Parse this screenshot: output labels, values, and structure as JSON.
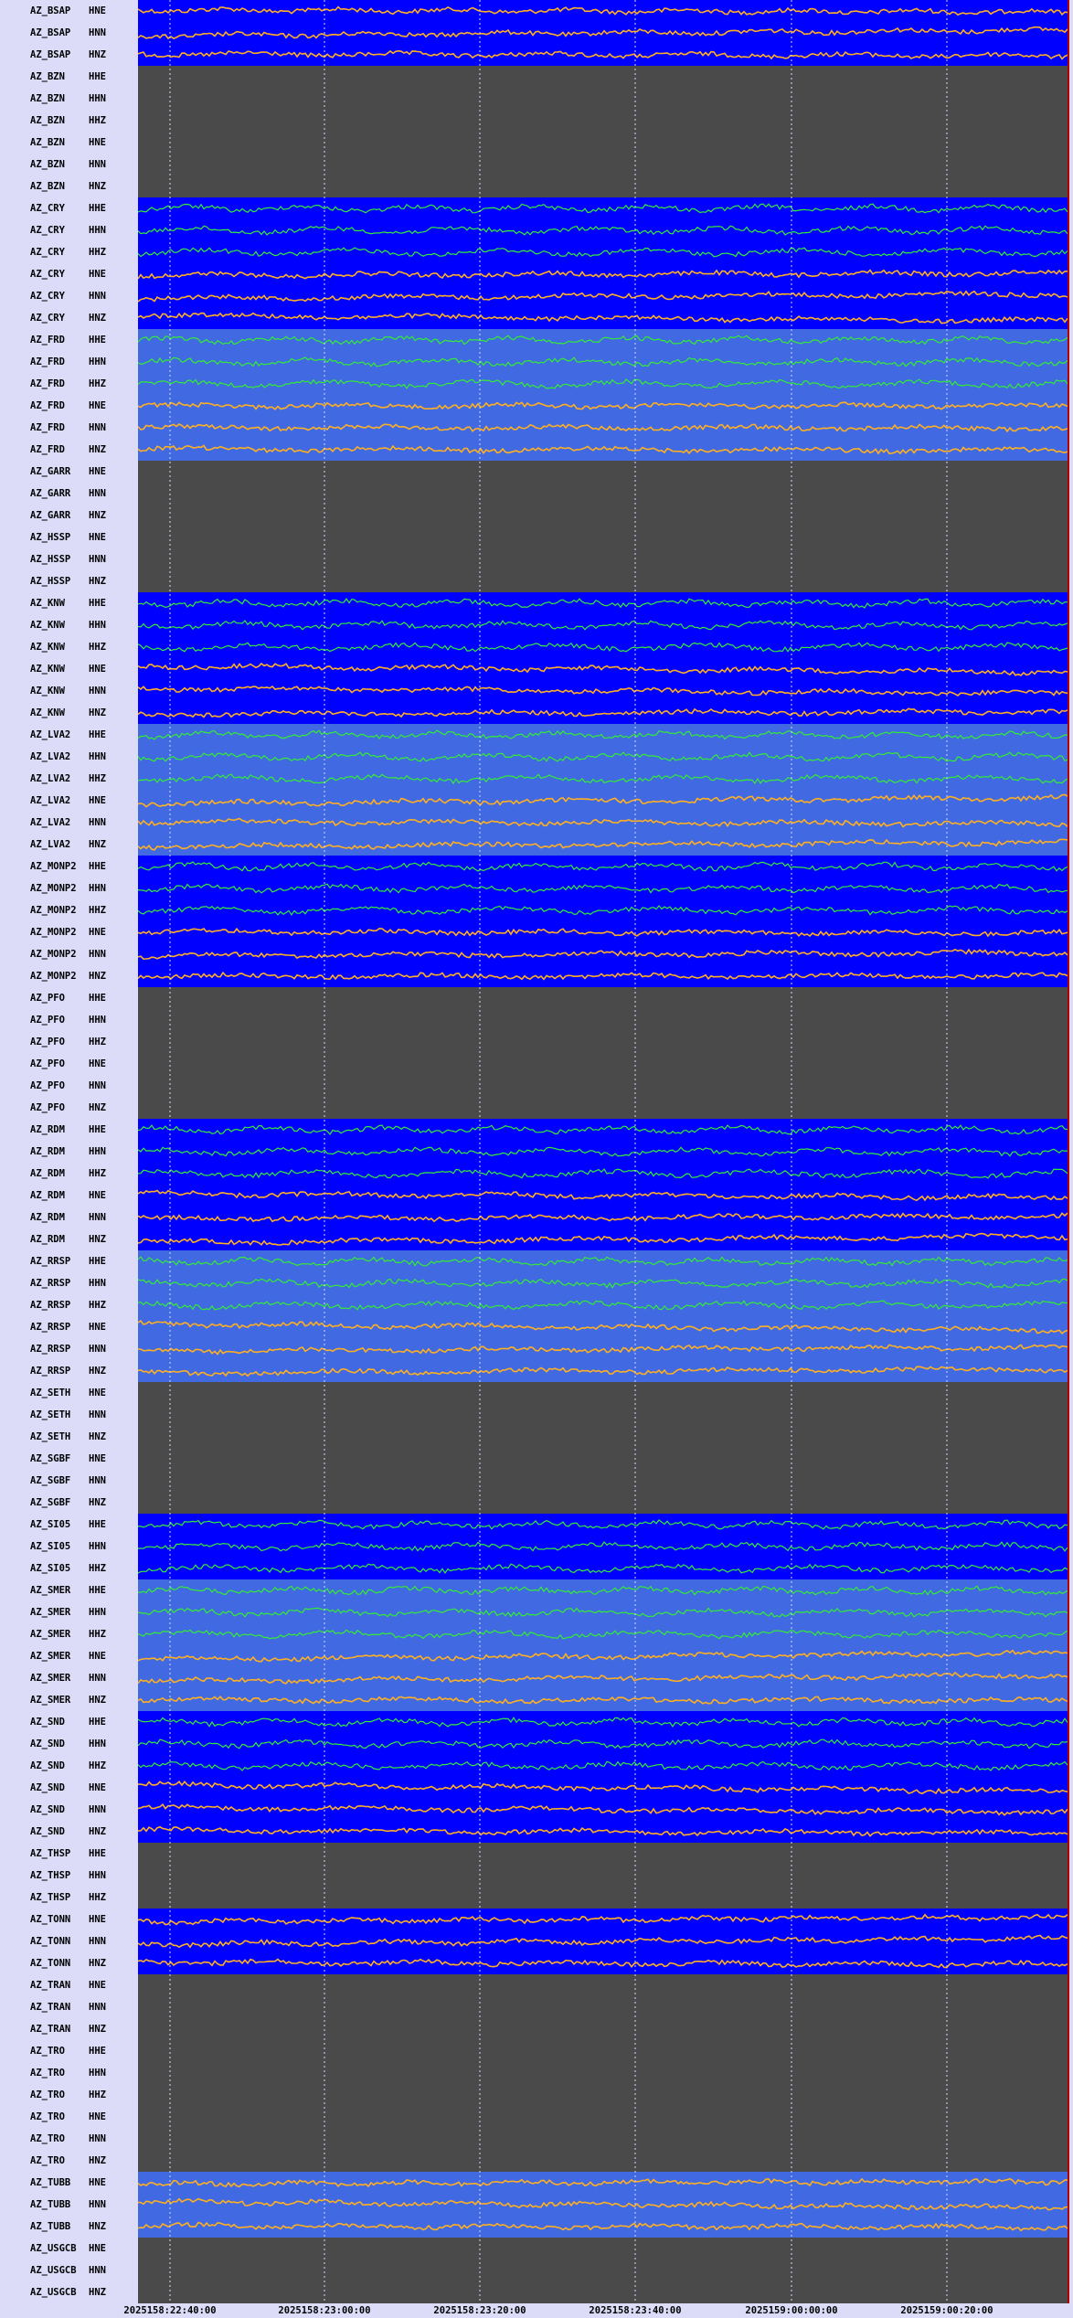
{
  "colors": {
    "background_panel": "#dcdcf8",
    "no_data": "#4a4a4a",
    "station_bg_dark": "#0000ff",
    "station_bg_light": "#4169e1",
    "trace_broadband": "#33ee33",
    "trace_strong_motion": "#ffb020",
    "gridline": "#d8d8ff"
  },
  "chart_data": {
    "type": "line",
    "title": "",
    "xlabel": "",
    "ylabel": "",
    "x_ticks": [
      "2025158:22:40:00",
      "2025158:23:00:00",
      "2025158:23:20:00",
      "2025158:23:40:00",
      "2025159:00:00:00",
      "2025159:00:20:00"
    ],
    "stations": [
      {
        "station": "AZ_BSAP",
        "channels": [
          "HNE",
          "HNN",
          "HNZ"
        ],
        "status": "data",
        "bg": "dark"
      },
      {
        "station": "AZ_BZN",
        "channels": [
          "HHE",
          "HHN",
          "HHZ",
          "HNE",
          "HNN",
          "HNZ"
        ],
        "status": "no-data"
      },
      {
        "station": "AZ_CRY",
        "channels": [
          "HHE",
          "HHN",
          "HHZ",
          "HNE",
          "HNN",
          "HNZ"
        ],
        "status": "data",
        "bg": "dark"
      },
      {
        "station": "AZ_FRD",
        "channels": [
          "HHE",
          "HHN",
          "HHZ",
          "HNE",
          "HNN",
          "HNZ"
        ],
        "status": "data",
        "bg": "light"
      },
      {
        "station": "AZ_GARR",
        "channels": [
          "HNE",
          "HNN",
          "HNZ"
        ],
        "status": "no-data"
      },
      {
        "station": "AZ_HSSP",
        "channels": [
          "HNE",
          "HNN",
          "HNZ"
        ],
        "status": "no-data"
      },
      {
        "station": "AZ_KNW",
        "channels": [
          "HHE",
          "HHN",
          "HHZ",
          "HNE",
          "HNN",
          "HNZ"
        ],
        "status": "data",
        "bg": "dark"
      },
      {
        "station": "AZ_LVA2",
        "channels": [
          "HHE",
          "HHN",
          "HHZ",
          "HNE",
          "HNN",
          "HNZ"
        ],
        "status": "data",
        "bg": "light"
      },
      {
        "station": "AZ_MONP2",
        "channels": [
          "HHE",
          "HHN",
          "HHZ",
          "HNE",
          "HNN",
          "HNZ"
        ],
        "status": "data",
        "bg": "dark"
      },
      {
        "station": "AZ_PFO",
        "channels": [
          "HHE",
          "HHN",
          "HHZ",
          "HNE",
          "HNN",
          "HNZ"
        ],
        "status": "no-data"
      },
      {
        "station": "AZ_RDM",
        "channels": [
          "HHE",
          "HHN",
          "HHZ",
          "HNE",
          "HNN",
          "HNZ"
        ],
        "status": "data",
        "bg": "dark"
      },
      {
        "station": "AZ_RRSP",
        "channels": [
          "HHE",
          "HHN",
          "HHZ",
          "HNE",
          "HNN",
          "HNZ"
        ],
        "status": "data",
        "bg": "light"
      },
      {
        "station": "AZ_SETH",
        "channels": [
          "HNE",
          "HNN",
          "HNZ"
        ],
        "status": "no-data"
      },
      {
        "station": "AZ_SGBF",
        "channels": [
          "HNE",
          "HNN",
          "HNZ"
        ],
        "status": "no-data"
      },
      {
        "station": "AZ_SI05",
        "channels": [
          "HHE",
          "HHN",
          "HHZ"
        ],
        "status": "data",
        "bg": "dark"
      },
      {
        "station": "AZ_SMER",
        "channels": [
          "HHE",
          "HHN",
          "HHZ",
          "HNE",
          "HNN",
          "HNZ"
        ],
        "status": "data",
        "bg": "light"
      },
      {
        "station": "AZ_SND",
        "channels": [
          "HHE",
          "HHN",
          "HHZ",
          "HNE",
          "HNN",
          "HNZ"
        ],
        "status": "data",
        "bg": "dark"
      },
      {
        "station": "AZ_THSP",
        "channels": [
          "HHE",
          "HHN",
          "HHZ"
        ],
        "status": "no-data"
      },
      {
        "station": "AZ_TONN",
        "channels": [
          "HNE",
          "HNN",
          "HNZ"
        ],
        "status": "data",
        "bg": "dark"
      },
      {
        "station": "AZ_TRAN",
        "channels": [
          "HNE",
          "HNN",
          "HNZ"
        ],
        "status": "no-data"
      },
      {
        "station": "AZ_TRO",
        "channels": [
          "HHE",
          "HHN",
          "HHZ",
          "HNE",
          "HNN",
          "HNZ"
        ],
        "status": "no-data"
      },
      {
        "station": "AZ_TUBB",
        "channels": [
          "HNE",
          "HNN",
          "HNZ"
        ],
        "status": "data",
        "bg": "light"
      },
      {
        "station": "AZ_USGCB",
        "channels": [
          "HNE",
          "HNN",
          "HNZ"
        ],
        "status": "no-data"
      }
    ]
  }
}
